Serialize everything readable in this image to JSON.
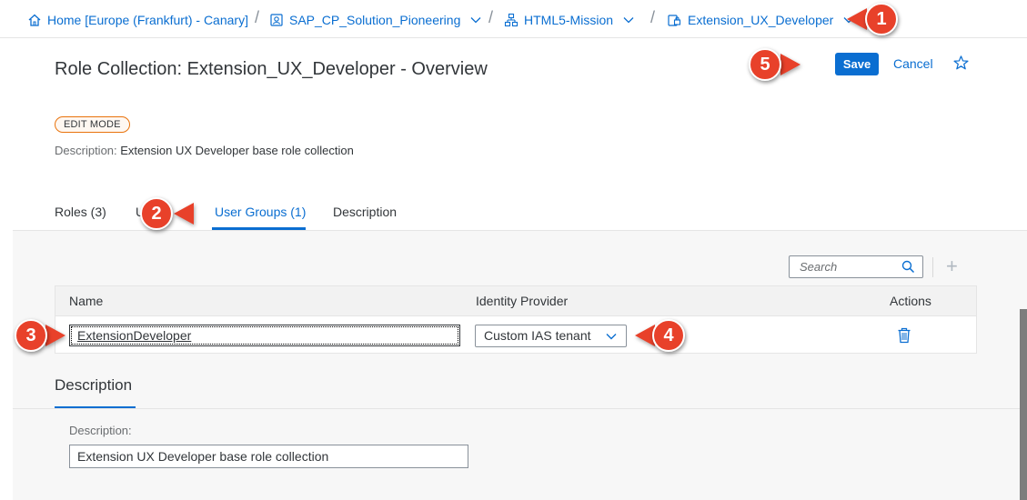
{
  "breadcrumbs": [
    {
      "label": "Home [Europe (Frankfurt) - Canary]",
      "icon": "home-icon"
    },
    {
      "label": "SAP_CP_Solution_Pioneering",
      "icon": "global-account-icon"
    },
    {
      "label": "HTML5-Mission",
      "icon": "hierarchy-icon"
    },
    {
      "label": "Extension_UX_Developer",
      "icon": "role-collection-icon"
    }
  ],
  "header": {
    "title": "Role Collection: Extension_UX_Developer - Overview",
    "save_label": "Save",
    "cancel_label": "Cancel",
    "mode_badge": "EDIT MODE",
    "description_label": "Description:",
    "description_value": "Extension UX Developer base role collection"
  },
  "tabs": [
    {
      "label": "Roles (3)"
    },
    {
      "label": "U"
    },
    {
      "label": "User Groups (1)",
      "active": true
    },
    {
      "label": "Description"
    }
  ],
  "user_groups": {
    "search_placeholder": "Search",
    "columns": [
      "Name",
      "Identity Provider",
      "Actions"
    ],
    "rows": [
      {
        "name": "ExtensionDeveloper",
        "identity_provider": "Custom IAS tenant"
      }
    ]
  },
  "description_section": {
    "title": "Description",
    "field_label": "Description:",
    "field_value": "Extension UX Developer base role collection"
  },
  "callouts": [
    "1",
    "2",
    "3",
    "4",
    "5"
  ],
  "colors": {
    "accent": "#0a6ed1",
    "callout": "#e8412a",
    "badge_border": "#e9730c"
  }
}
